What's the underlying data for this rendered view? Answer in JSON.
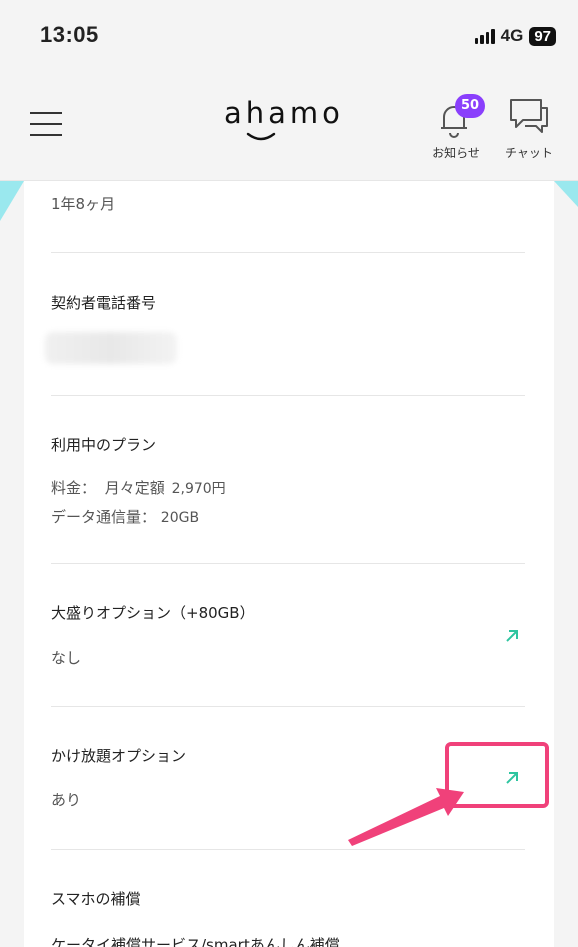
{
  "status_bar": {
    "time": "13:05",
    "network": "4G",
    "battery": "97"
  },
  "header": {
    "logo_text": "ahamo",
    "notifications": {
      "label": "お知らせ",
      "badge": "50"
    },
    "chat": {
      "label": "チャット"
    }
  },
  "sections": {
    "tenure": {
      "value": "1年8ヶ月"
    },
    "phone": {
      "title": "契約者電話番号"
    },
    "plan": {
      "title": "利用中のプラン",
      "fee_label": "料金：",
      "fee_plan": "月々定額",
      "fee_value": "2,970円",
      "data_label": "データ通信量：",
      "data_value": "20GB"
    },
    "large_option": {
      "title": "大盛りオプション（+80GB）",
      "value": "なし"
    },
    "call_option": {
      "title": "かけ放題オプション",
      "value": "あり"
    },
    "phone_insurance": {
      "title": "スマホの補償",
      "sub": "ケータイ補償サービス/smartあんしん補償"
    }
  },
  "colors": {
    "accent_teal": "#2ec5a0",
    "badge_purple": "#8a3ffc",
    "highlight_pink": "#f0417a",
    "deco_cyan": "#9ae8ee"
  }
}
